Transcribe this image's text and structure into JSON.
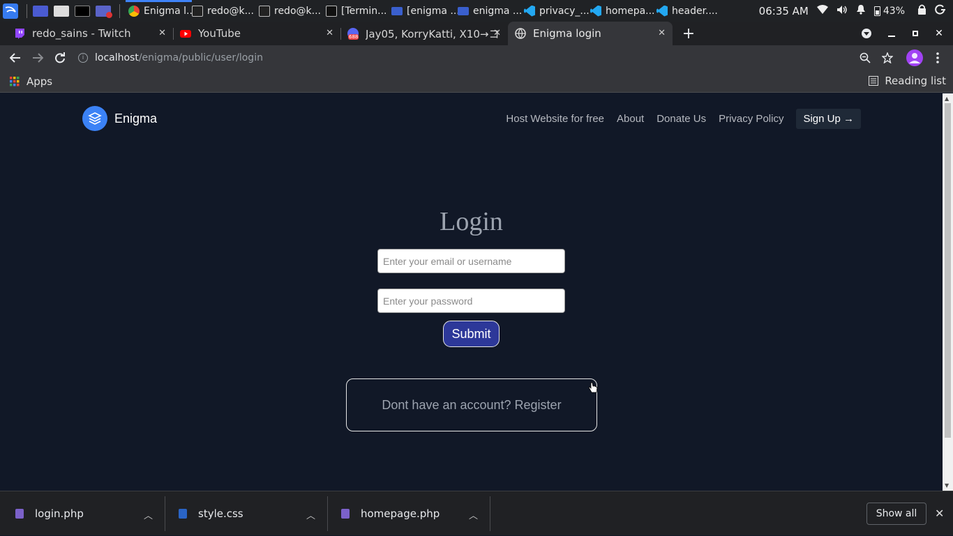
{
  "taskbar": {
    "apps": [
      {
        "label": "Enigma l..."
      },
      {
        "label": "redo@k..."
      },
      {
        "label": "redo@k..."
      },
      {
        "label": "[Termin..."
      },
      {
        "label": "[enigma ..."
      },
      {
        "label": "enigma ..."
      },
      {
        "label": "privacy_..."
      },
      {
        "label": "homepa..."
      },
      {
        "label": "header...."
      }
    ],
    "time": "06:35 AM",
    "battery": "43%"
  },
  "tabs": [
    {
      "title": "redo_sains - Twitch",
      "icon": "twitch-icon"
    },
    {
      "title": "YouTube",
      "icon": "youtube-icon"
    },
    {
      "title": "Jay05, KorryKatti, X10→コ",
      "icon": "discord-icon",
      "badge": "688"
    },
    {
      "title": "Enigma login",
      "icon": "globe-icon",
      "active": true
    }
  ],
  "toolbar": {
    "url_host": "localhost",
    "url_path": "/enigma/public/user/login"
  },
  "bookmarks": {
    "apps_label": "Apps",
    "reading_list": "Reading list"
  },
  "site": {
    "brand": "Enigma",
    "nav": [
      "Host Website for free",
      "About",
      "Donate Us",
      "Privacy Policy"
    ],
    "signup": "Sign Up →"
  },
  "login": {
    "title": "Login",
    "email_placeholder": "Enter your email or username",
    "password_placeholder": "Enter your password",
    "submit": "Submit",
    "register_text": "Dont have an account? Register"
  },
  "downloads": {
    "files": [
      "login.php",
      "style.css",
      "homepage.php"
    ],
    "show_all": "Show all"
  },
  "colors": {
    "page_bg": "#111827",
    "accent": "#3b82f6",
    "submit_bg": "#2d3899"
  }
}
